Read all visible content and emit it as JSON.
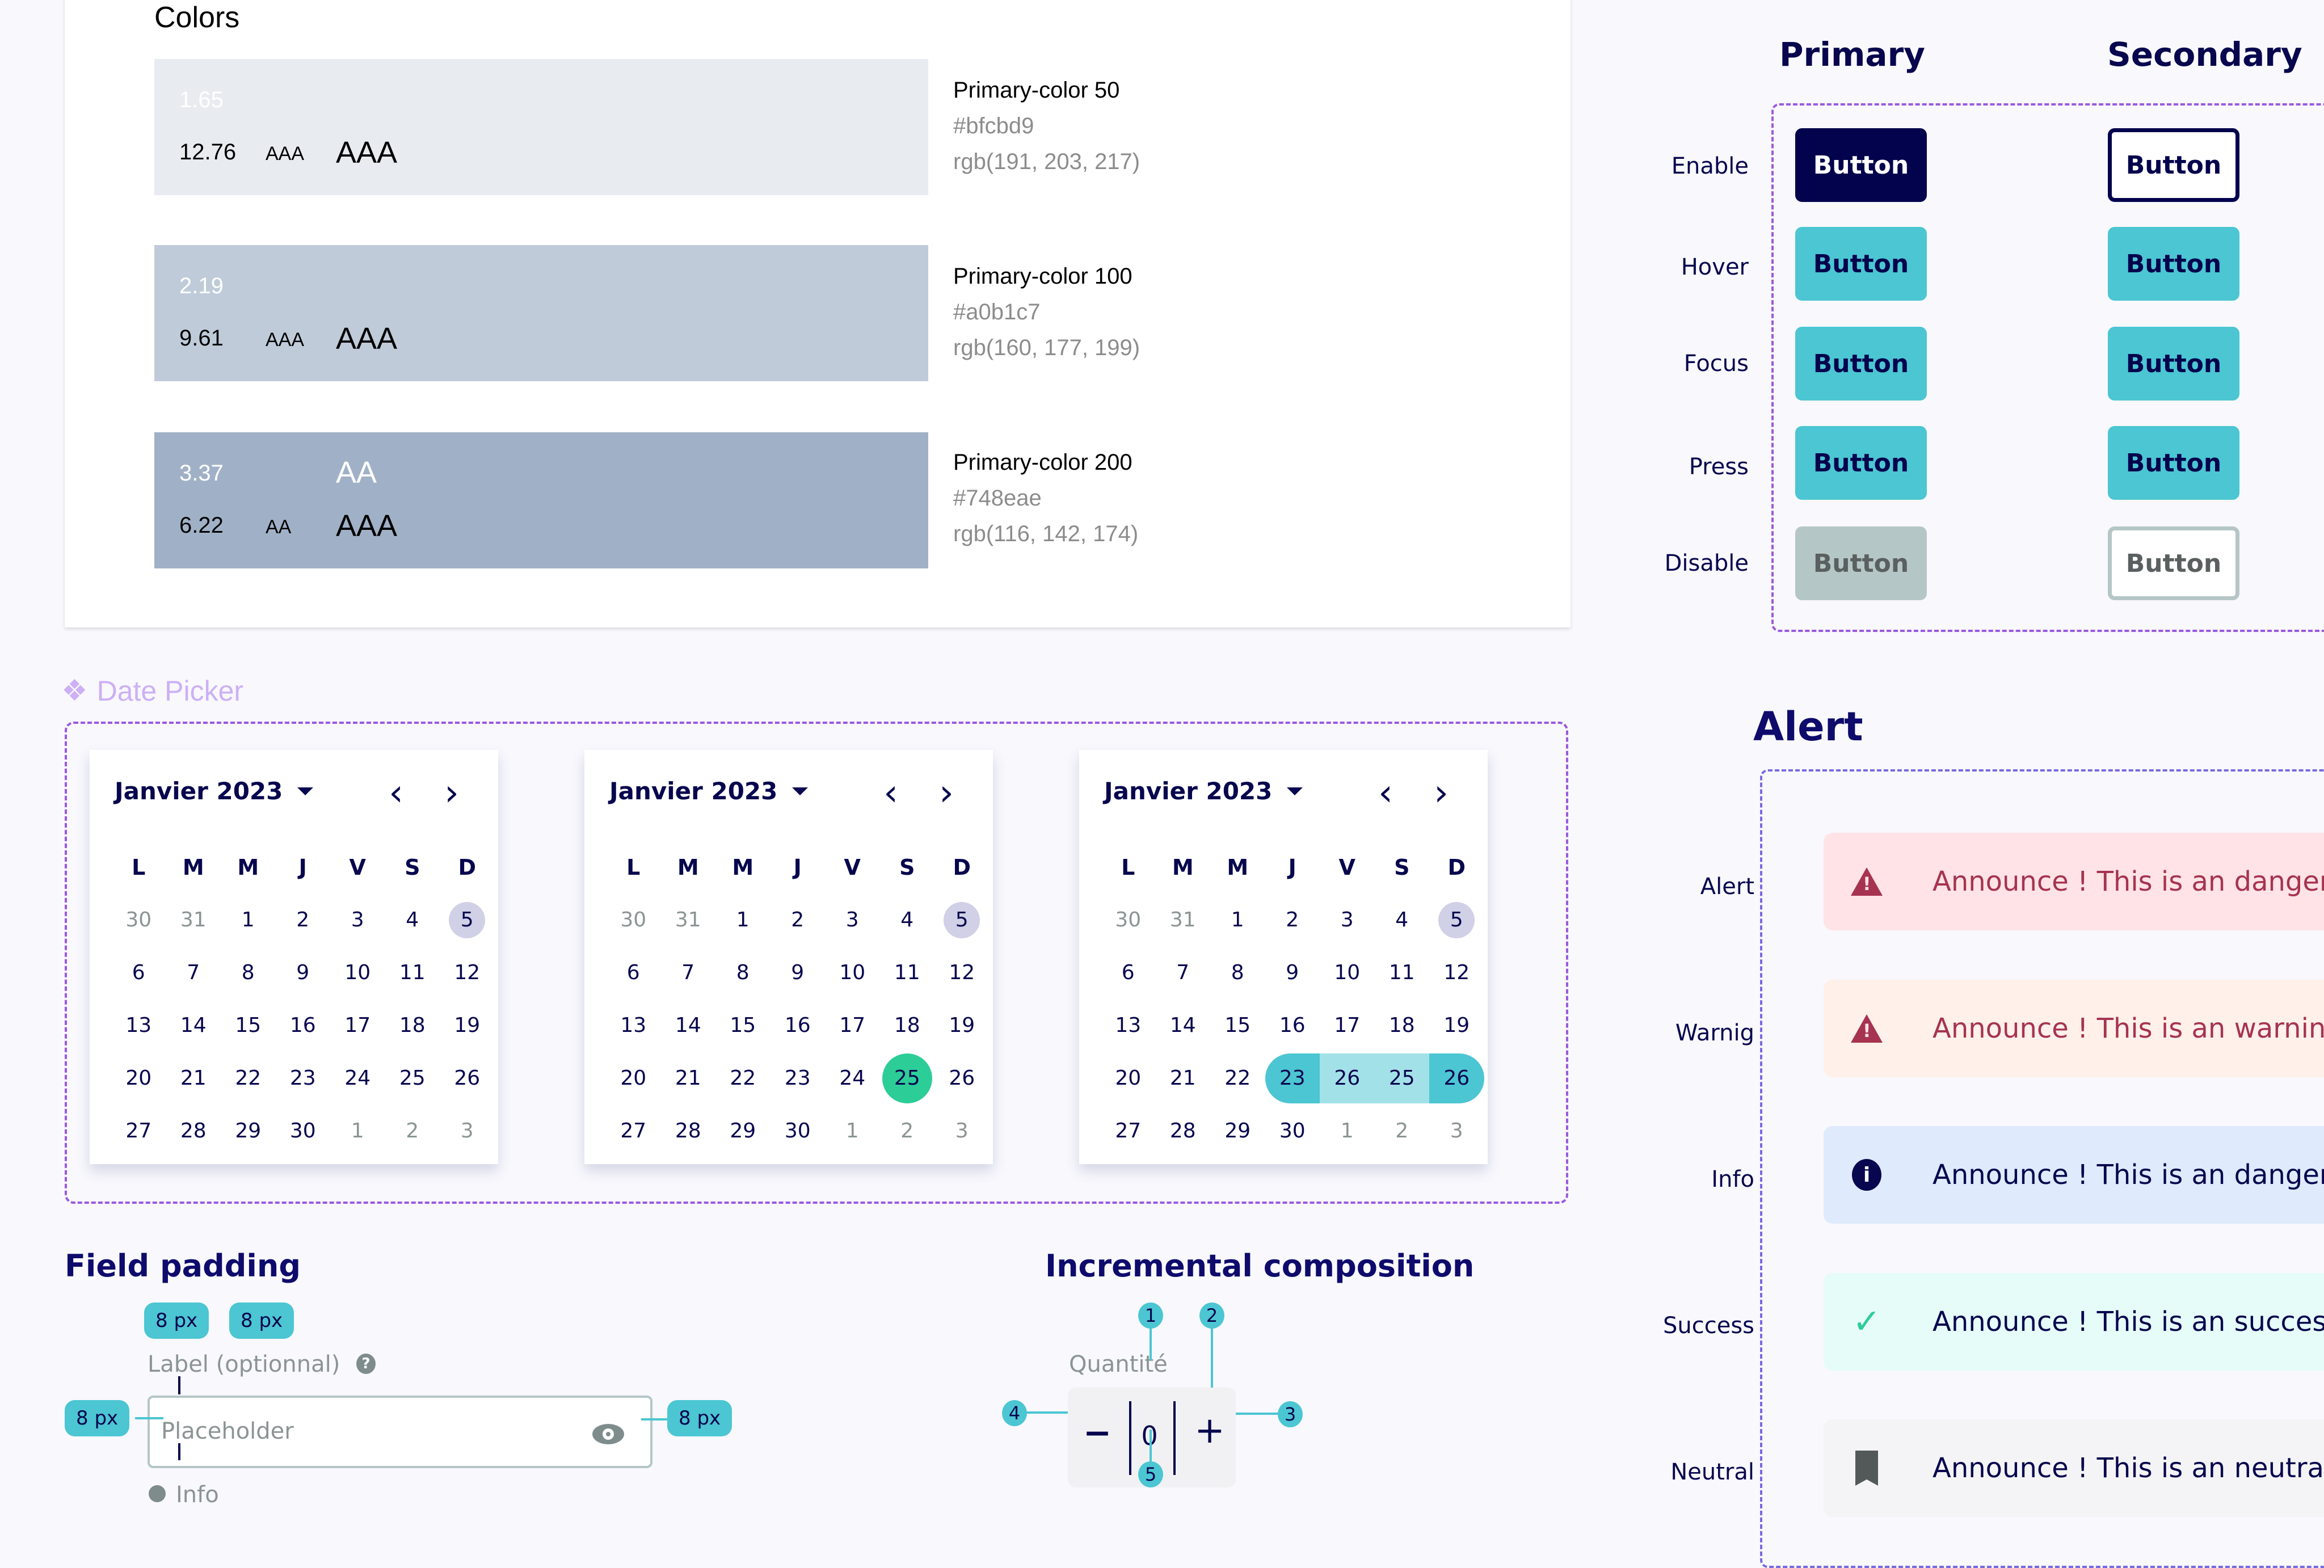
{
  "colors": {
    "title": "Colors",
    "swatches": [
      {
        "bg": "#e8ebf0",
        "top_ratio": "1.65",
        "top_rating": "",
        "bottom_ratio": "12.76",
        "bottom_small": "AAA",
        "bottom_large": "AAA",
        "name": "Primary-color 50",
        "hex": "#bfcbd9",
        "rgb": "rgb(191, 203, 217)"
      },
      {
        "bg": "#bfcbd9",
        "top_ratio": "2.19",
        "top_rating": "",
        "bottom_ratio": "9.61",
        "bottom_small": "AAA",
        "bottom_large": "AAA",
        "name": "Primary-color 100",
        "hex": "#a0b1c7",
        "rgb": "rgb(160, 177, 199)"
      },
      {
        "bg": "#a0b1c7",
        "top_ratio": "3.37",
        "top_rating": "AA",
        "bottom_ratio": "6.22",
        "bottom_small": "AA",
        "bottom_large": "AAA",
        "name": "Primary-color 200",
        "hex": "#748eae",
        "rgb": "rgb(116, 142, 174)"
      }
    ]
  },
  "buttons": {
    "columns": [
      "Primary",
      "Secondary"
    ],
    "states": [
      "Enable",
      "Hover",
      "Focus",
      "Press",
      "Disable"
    ],
    "label": "Button"
  },
  "date_picker": {
    "title": "Date Picker",
    "month_label": "Janvier 2023",
    "weekdays": [
      "L",
      "M",
      "M",
      "J",
      "V",
      "S",
      "D"
    ],
    "calendars": [
      {
        "variant": "default",
        "weeks": [
          [
            "30",
            "31",
            "1",
            "2",
            "3",
            "4",
            "5"
          ],
          [
            "6",
            "7",
            "8",
            "9",
            "10",
            "11",
            "12"
          ],
          [
            "13",
            "14",
            "15",
            "16",
            "17",
            "18",
            "19"
          ],
          [
            "20",
            "21",
            "22",
            "23",
            "24",
            "25",
            "26"
          ],
          [
            "27",
            "28",
            "29",
            "30",
            "1",
            "2",
            "3"
          ]
        ]
      },
      {
        "variant": "single-selected",
        "selected": "25",
        "weeks": [
          [
            "30",
            "31",
            "1",
            "2",
            "3",
            "4",
            "5"
          ],
          [
            "6",
            "7",
            "8",
            "9",
            "10",
            "11",
            "12"
          ],
          [
            "13",
            "14",
            "15",
            "16",
            "17",
            "18",
            "19"
          ],
          [
            "20",
            "21",
            "22",
            "23",
            "24",
            "25",
            "26"
          ],
          [
            "27",
            "28",
            "29",
            "30",
            "1",
            "2",
            "3"
          ]
        ]
      },
      {
        "variant": "range",
        "weeks": [
          [
            "30",
            "31",
            "1",
            "2",
            "3",
            "4",
            "5"
          ],
          [
            "6",
            "7",
            "8",
            "9",
            "10",
            "11",
            "12"
          ],
          [
            "13",
            "14",
            "15",
            "16",
            "17",
            "18",
            "19"
          ],
          [
            "20",
            "21",
            "22",
            "23",
            "26",
            "25",
            "26"
          ],
          [
            "27",
            "28",
            "29",
            "30",
            "1",
            "2",
            "3"
          ]
        ]
      }
    ],
    "today": "5"
  },
  "field_padding": {
    "title": "Field padding",
    "badge": "8 px",
    "label": "Label (optionnal)",
    "placeholder": "Placeholder",
    "info": "Info"
  },
  "incremental": {
    "title": "Incremental composition",
    "label": "Quantité",
    "value": "0",
    "minus": "−",
    "plus": "+",
    "markers": [
      "1",
      "2",
      "3",
      "4",
      "5"
    ]
  },
  "alerts": {
    "title": "Alert",
    "items": [
      {
        "label": "Alert",
        "text": "Announce ! This is an danger ba",
        "bg": "#ffe3e7",
        "color": "#a6334f",
        "icon": "warning-icon"
      },
      {
        "label": "Warnig",
        "text": "Announce ! This is an warning ba",
        "bg": "#fff0ea",
        "color": "#a6334f",
        "icon": "warning-icon"
      },
      {
        "label": "Info",
        "text": "Announce ! This is an danger ba",
        "bg": "#dfeafd",
        "color": "#07064e",
        "icon": "info-icon"
      },
      {
        "label": "Success",
        "text": "Announce ! This is an success ba",
        "bg": "#e6fcf8",
        "color": "#07064e",
        "icon": "check-icon"
      },
      {
        "label": "Neutral",
        "text": "Announce ! This is an neutral ba",
        "bg": "#f4f4f6",
        "color": "#07064e",
        "icon": "bookmark-icon"
      }
    ]
  }
}
